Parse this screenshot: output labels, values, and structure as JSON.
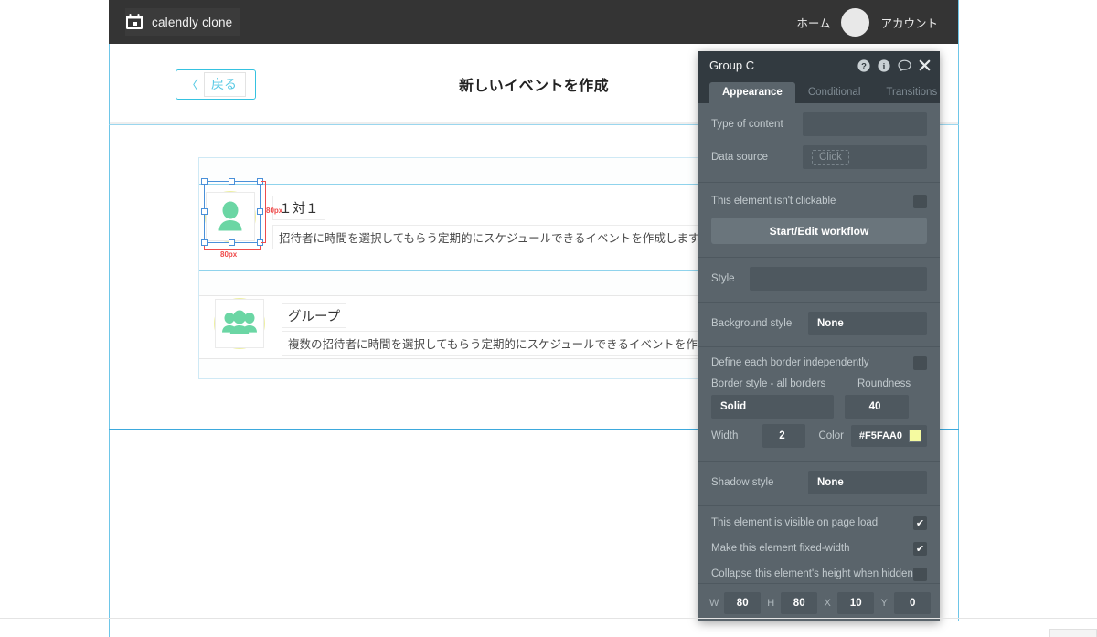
{
  "appbar": {
    "brand_icon": "calendar-icon",
    "brand": "calendly clone",
    "home_label": "ホーム",
    "account_label": "アカウント"
  },
  "page": {
    "back_chevron": "〈",
    "back_label": "戻る",
    "title": "新しいイベントを作成"
  },
  "list": {
    "items": [
      {
        "icon": "person-icon",
        "title": "１対１",
        "desc": "招待者に時間を選択してもらう定期的にスケジュールできるイベントを作成します。"
      },
      {
        "icon": "group-icon",
        "title": "グループ",
        "desc": "複数の招待者に時間を選択してもらう定期的にスケジュールできるイベントを作成します。"
      }
    ]
  },
  "selection": {
    "width_label": "80px",
    "height_label": "80px"
  },
  "panel": {
    "title": "Group C",
    "icons": [
      "help-icon",
      "info-icon",
      "comment-icon",
      "close-icon"
    ],
    "tabs": [
      {
        "label": "Appearance",
        "active": true
      },
      {
        "label": "Conditional",
        "active": false
      },
      {
        "label": "Transitions",
        "active": false
      }
    ],
    "type_of_content_label": "Type of content",
    "type_of_content_value": "",
    "data_source_label": "Data source",
    "data_source_placeholder": "Click",
    "not_clickable_label": "This element isn't clickable",
    "not_clickable_checked": "",
    "workflow_button": "Start/Edit workflow",
    "style_label": "Style",
    "style_value": "",
    "background_style_label": "Background style",
    "background_style_value": "None",
    "define_borders_label": "Define each border independently",
    "define_borders_checked": "",
    "border_style_label": "Border style - all borders",
    "border_style_value": "Solid",
    "roundness_label": "Roundness",
    "roundness_value": "40",
    "width_label": "Width",
    "width_value": "2",
    "color_label": "Color",
    "color_value": "#F5FAA0",
    "shadow_style_label": "Shadow style",
    "shadow_style_value": "None",
    "visible_label": "This element is visible on page load",
    "visible_checked": "✔",
    "fixed_width_label": "Make this element fixed-width",
    "fixed_width_checked": "✔",
    "collapse_label": "Collapse this element's height when hidden",
    "collapse_checked": "",
    "geometry": {
      "w_label": "W",
      "w_value": "80",
      "h_label": "H",
      "h_value": "80",
      "x_label": "X",
      "x_value": "10",
      "y_label": "Y",
      "y_value": "0"
    }
  },
  "colors": {
    "panel_bg": "#5a646b",
    "panel_title_bg": "#323a40",
    "appbar_bg": "#343434",
    "accent_cyan": "#35c2e0",
    "guide_cyan": "#6ec6e8",
    "icon_green": "#6bd6a4",
    "ring_yellow": "#edefa1",
    "dim_red": "#ef4b4b",
    "border_color": "#F5FAA0"
  }
}
